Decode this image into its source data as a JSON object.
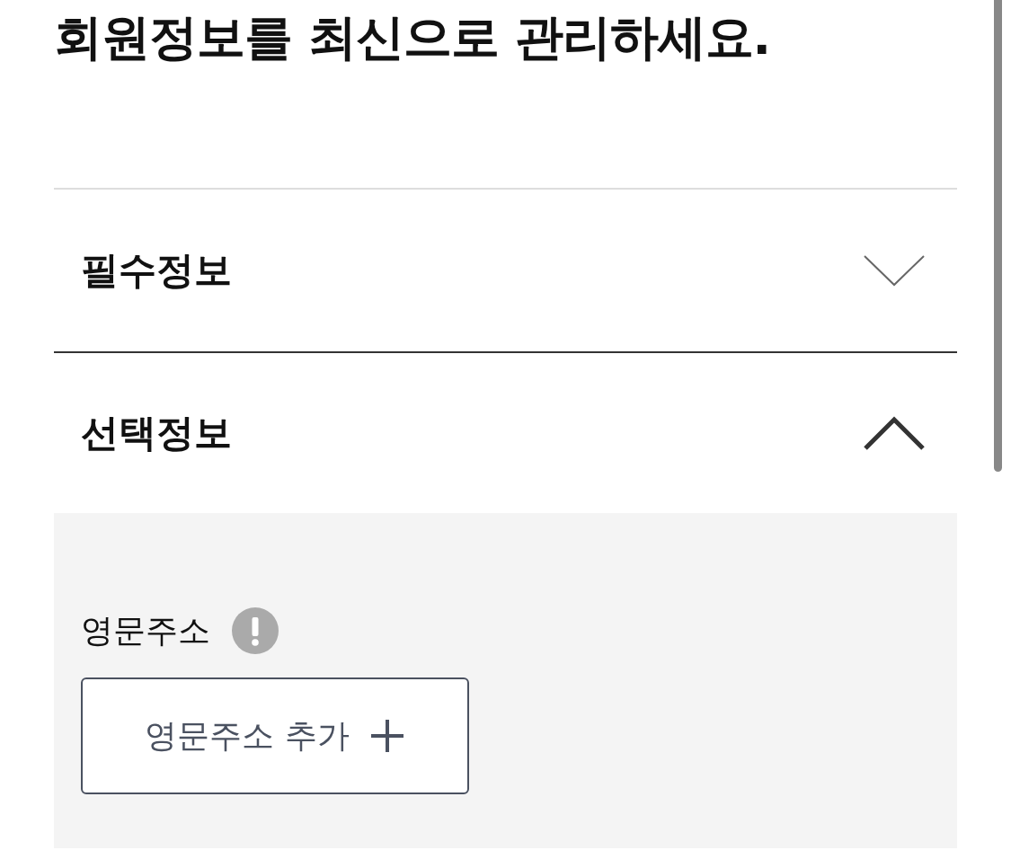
{
  "title": "회원정보를 최신으로 관리하세요.",
  "sections": [
    {
      "label": "필수정보",
      "expanded": false
    },
    {
      "label": "선택정보",
      "expanded": true,
      "fields": [
        {
          "label": "영문주소",
          "button": "영문주소 추가"
        }
      ]
    }
  ]
}
